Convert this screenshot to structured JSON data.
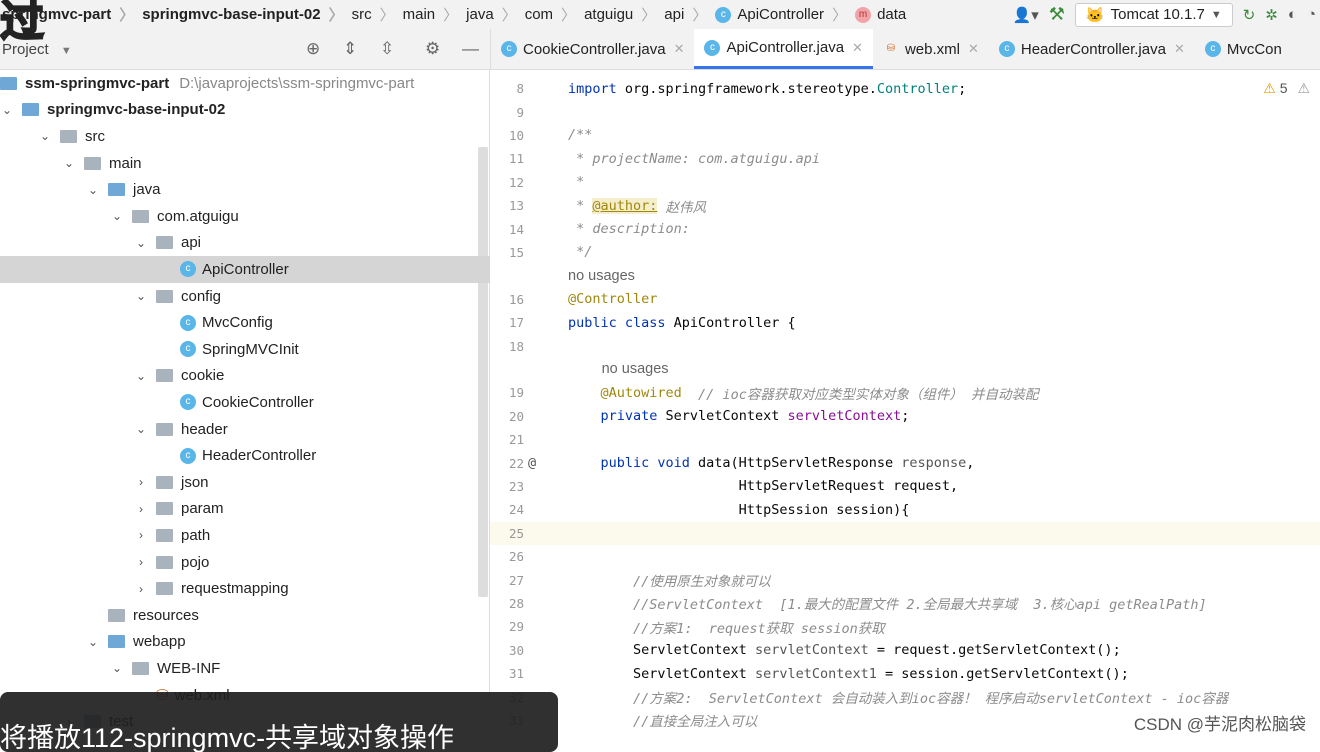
{
  "breadcrumb": [
    "springmvc-part",
    "springmvc-base-input-02",
    "src",
    "main",
    "java",
    "com",
    "atguigu",
    "api",
    "ApiController",
    "data"
  ],
  "run_config": "Tomcat 10.1.7",
  "project_panel": {
    "title": "Project"
  },
  "tabs": [
    {
      "label": "CookieController.java",
      "icon": "class"
    },
    {
      "label": "ApiController.java",
      "icon": "class",
      "active": true
    },
    {
      "label": "web.xml",
      "icon": "xml"
    },
    {
      "label": "HeaderController.java",
      "icon": "class"
    },
    {
      "label": "MvcCon",
      "icon": "class"
    }
  ],
  "tree": [
    {
      "label": "ssm-springmvc-part",
      "path": "D:\\javaprojects\\ssm-springmvc-part",
      "depth": 0,
      "type": "module",
      "bold": true
    },
    {
      "label": "springmvc-base-input-02",
      "depth": 0,
      "type": "module",
      "bold": true,
      "expanded": true
    },
    {
      "label": "src",
      "depth": 1,
      "type": "folder",
      "expanded": true
    },
    {
      "label": "main",
      "depth": 2,
      "type": "folder",
      "expanded": true
    },
    {
      "label": "java",
      "depth": 3,
      "type": "source",
      "expanded": true
    },
    {
      "label": "com.atguigu",
      "depth": 4,
      "type": "package",
      "expanded": true
    },
    {
      "label": "api",
      "depth": 5,
      "type": "package",
      "expanded": true
    },
    {
      "label": "ApiController",
      "depth": 6,
      "type": "class",
      "selected": true
    },
    {
      "label": "config",
      "depth": 5,
      "type": "package",
      "expanded": true
    },
    {
      "label": "MvcConfig",
      "depth": 6,
      "type": "class"
    },
    {
      "label": "SpringMVCInit",
      "depth": 6,
      "type": "class"
    },
    {
      "label": "cookie",
      "depth": 5,
      "type": "package",
      "expanded": true
    },
    {
      "label": "CookieController",
      "depth": 6,
      "type": "class"
    },
    {
      "label": "header",
      "depth": 5,
      "type": "package",
      "expanded": true
    },
    {
      "label": "HeaderController",
      "depth": 6,
      "type": "class"
    },
    {
      "label": "json",
      "depth": 5,
      "type": "package",
      "expanded": false
    },
    {
      "label": "param",
      "depth": 5,
      "type": "package",
      "expanded": false
    },
    {
      "label": "path",
      "depth": 5,
      "type": "package",
      "expanded": false
    },
    {
      "label": "pojo",
      "depth": 5,
      "type": "package",
      "expanded": false
    },
    {
      "label": "requestmapping",
      "depth": 5,
      "type": "package",
      "expanded": false
    },
    {
      "label": "resources",
      "depth": 3,
      "type": "folder"
    },
    {
      "label": "webapp",
      "depth": 3,
      "type": "source",
      "expanded": true
    },
    {
      "label": "WEB-INF",
      "depth": 4,
      "type": "folder",
      "expanded": true
    },
    {
      "label": "web.xml",
      "depth": 5,
      "type": "xml"
    },
    {
      "label": "test",
      "depth": 2,
      "type": "folder",
      "expanded": false
    }
  ],
  "warnings": "5",
  "code": [
    {
      "n": "8",
      "t": [
        [
          "import ",
          "kw"
        ],
        [
          "org.springframework.stereotype.",
          "code"
        ],
        [
          "Controller",
          "cls"
        ],
        [
          ";",
          "code"
        ]
      ]
    },
    {
      "n": "9",
      "t": []
    },
    {
      "n": "10",
      "t": [
        [
          "/**",
          "cm"
        ]
      ]
    },
    {
      "n": "11",
      "t": [
        [
          " * projectName: com.atguigu.api",
          "cm"
        ]
      ]
    },
    {
      "n": "12",
      "t": [
        [
          " *",
          "cm"
        ]
      ]
    },
    {
      "n": "13",
      "t": [
        [
          " * ",
          "cm"
        ],
        [
          "@author:",
          "tag"
        ],
        [
          " 赵伟风",
          "cm"
        ]
      ]
    },
    {
      "n": "14",
      "t": [
        [
          " * description:",
          "cm"
        ]
      ]
    },
    {
      "n": "15",
      "t": [
        [
          " */",
          "cm"
        ]
      ]
    },
    {
      "n": "",
      "hint": "no usages",
      "indent": 0
    },
    {
      "n": "16",
      "t": [
        [
          "@Controller",
          "an"
        ]
      ]
    },
    {
      "n": "17",
      "t": [
        [
          "public class ",
          "kw"
        ],
        [
          "ApiController {",
          "code"
        ]
      ]
    },
    {
      "n": "18",
      "t": []
    },
    {
      "n": "",
      "hint": "no usages",
      "indent": 4
    },
    {
      "n": "19",
      "t": [
        [
          "    @Autowired",
          "an"
        ],
        [
          "  // ioc容器获取对应类型实体对象（组件） 并自动装配",
          "cm"
        ]
      ]
    },
    {
      "n": "20",
      "t": [
        [
          "    private ",
          "kw"
        ],
        [
          "ServletContext ",
          "code"
        ],
        [
          "servletContext",
          "var"
        ],
        [
          ";",
          "code"
        ]
      ]
    },
    {
      "n": "21",
      "t": []
    },
    {
      "n": "22",
      "t": [
        [
          "    public void ",
          "kw"
        ],
        [
          "data(HttpServletResponse ",
          "code"
        ],
        [
          "response",
          "lv"
        ],
        [
          ",",
          "code"
        ]
      ]
    },
    {
      "n": "23",
      "t": [
        [
          "                     HttpServletRequest request,",
          "code"
        ]
      ]
    },
    {
      "n": "24",
      "t": [
        [
          "                     HttpSession session){",
          "code"
        ]
      ]
    },
    {
      "n": "25",
      "t": [],
      "current": true
    },
    {
      "n": "26",
      "t": []
    },
    {
      "n": "27",
      "t": [
        [
          "        //使用原生对象就可以",
          "cm"
        ]
      ]
    },
    {
      "n": "28",
      "t": [
        [
          "        //ServletContext  [1.最大的配置文件 2.全局最大共享域  3.核心api getRealPath]",
          "cm"
        ]
      ]
    },
    {
      "n": "29",
      "t": [
        [
          "        //方案1:  request获取 session获取",
          "cm"
        ]
      ]
    },
    {
      "n": "30",
      "t": [
        [
          "        ServletContext ",
          "code"
        ],
        [
          "servletContext",
          "lv"
        ],
        [
          " = request.getServletContext();",
          "code"
        ]
      ]
    },
    {
      "n": "31",
      "t": [
        [
          "        ServletContext ",
          "code"
        ],
        [
          "servletContext1",
          "lv"
        ],
        [
          " = session.getServletContext();",
          "code"
        ]
      ]
    },
    {
      "n": "32",
      "t": [
        [
          "        //方案2:  ServletContext 会自动装入到ioc容器！ 程序启动servletContext - ioc容器",
          "cm"
        ]
      ]
    },
    {
      "n": "33",
      "t": [
        [
          "        //直接全局注入可以",
          "cm"
        ]
      ]
    }
  ],
  "subtitle": "将播放112-springmvc-共享域对象操作",
  "watermark": "CSDN @芋泥肉松脑袋"
}
